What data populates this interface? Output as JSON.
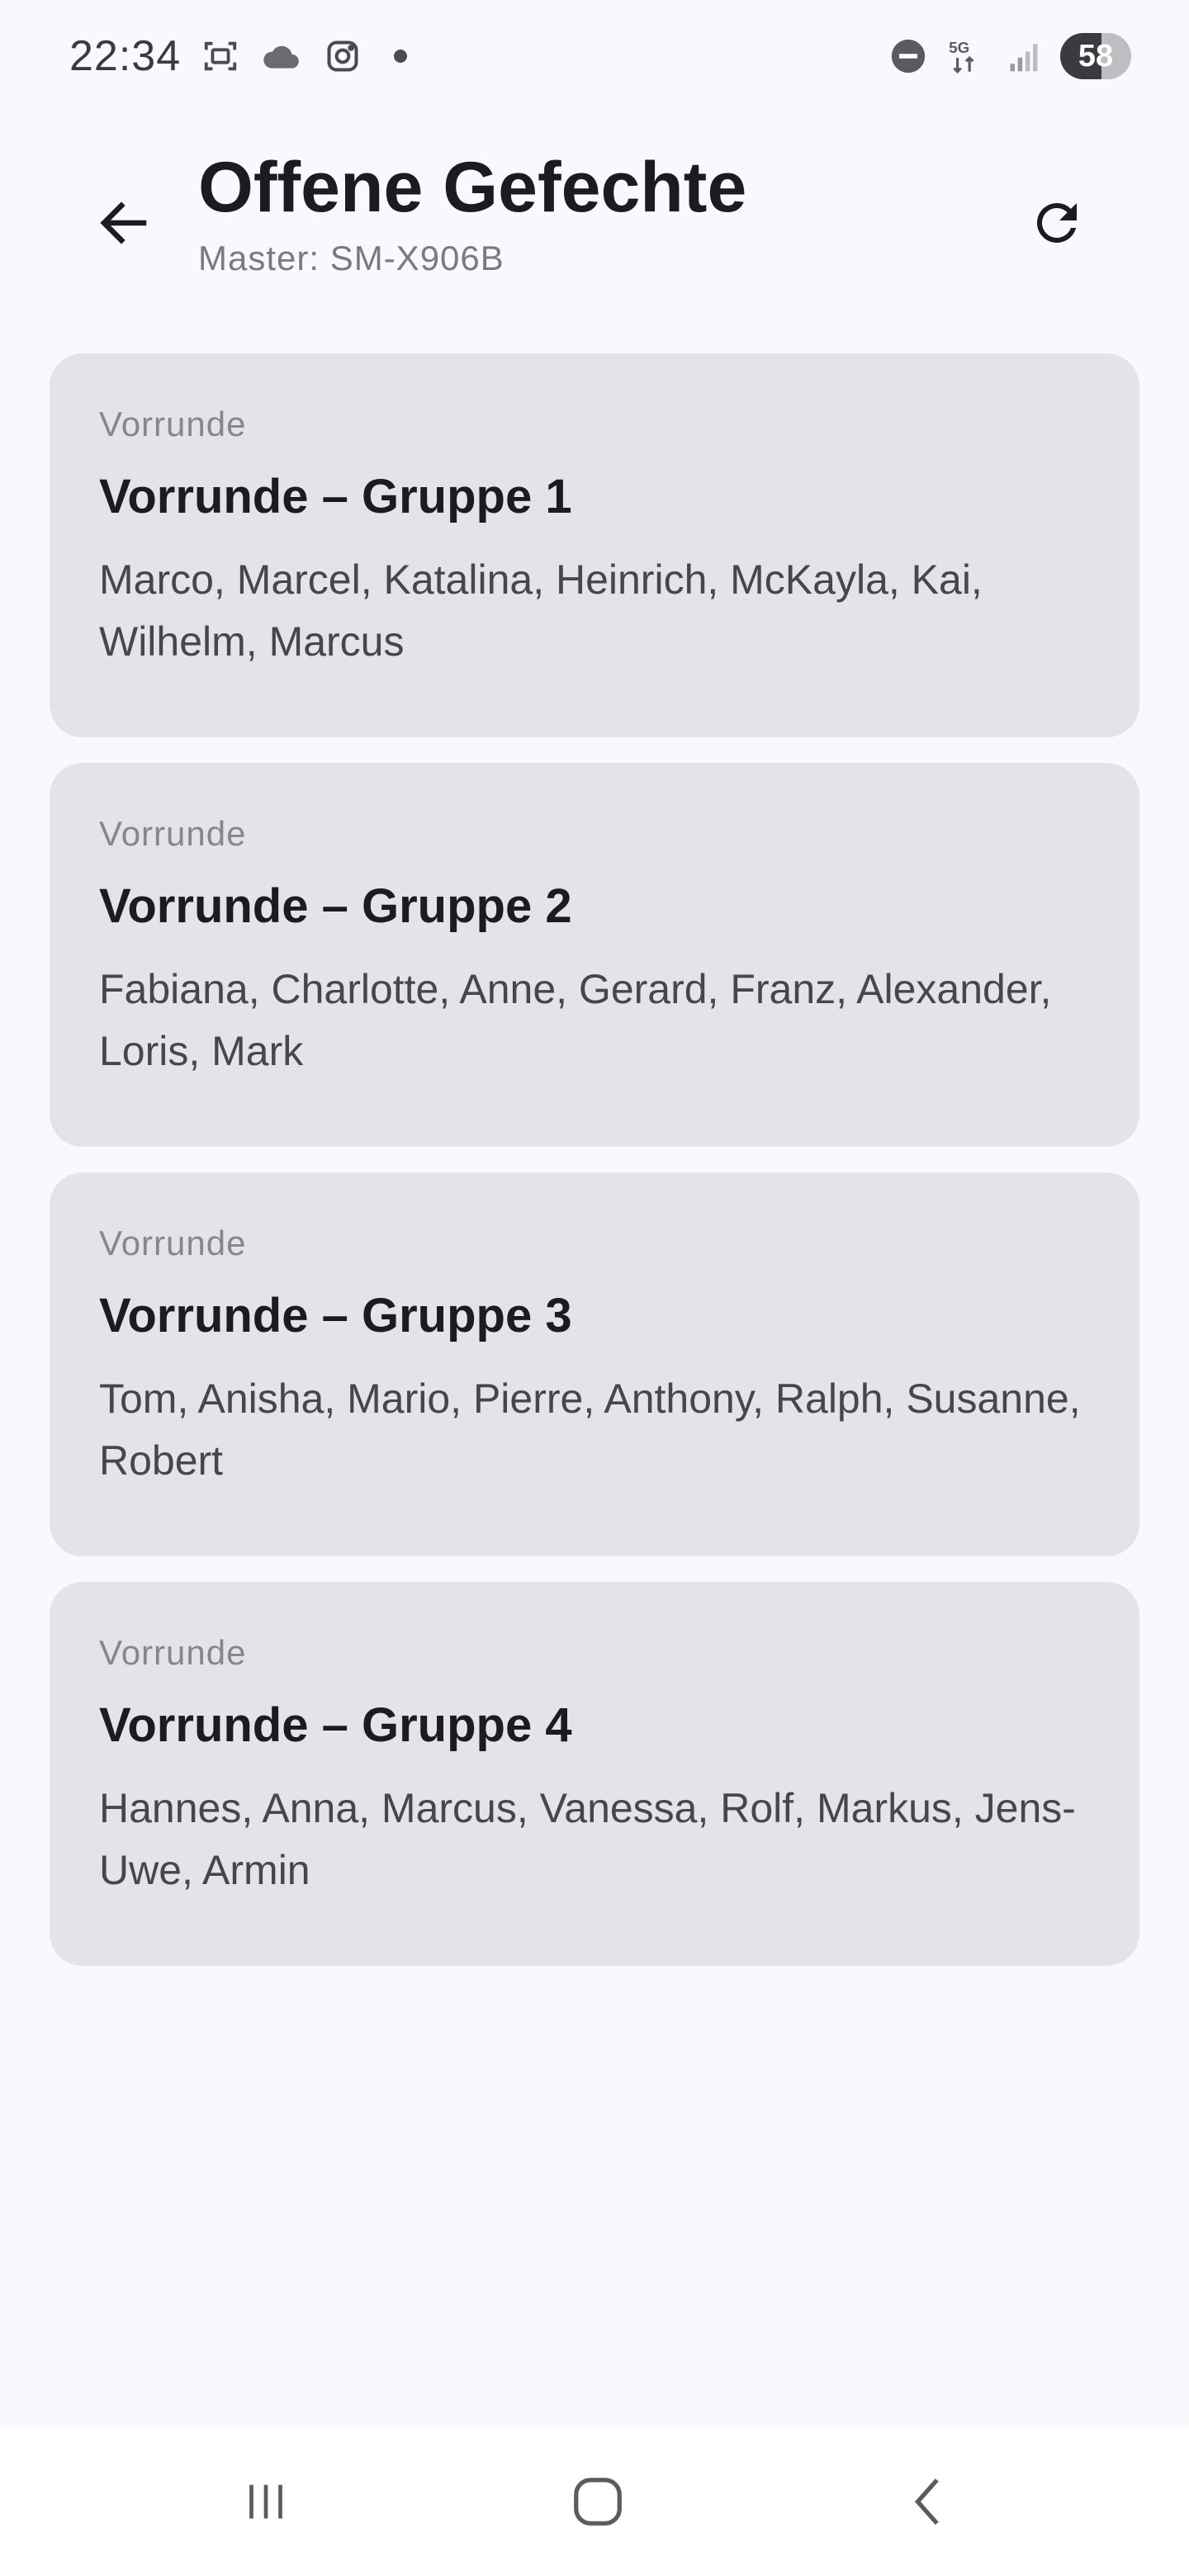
{
  "status_bar": {
    "time": "22:34",
    "network": "5G",
    "battery": "58",
    "battery_level": 0.58,
    "icons": [
      "screenshot-icon",
      "cloud-icon",
      "instagram-icon",
      "notification-dot-icon",
      "do-not-disturb-icon",
      "network-5g-icon",
      "signal-icon",
      "battery-icon"
    ]
  },
  "header": {
    "title": "Offene Gefechte",
    "subtitle": "Master: SM-X906B",
    "back_icon": "arrow-left-icon",
    "refresh_icon": "refresh-icon"
  },
  "fights": [
    {
      "round": "Vorrunde",
      "title": "Vorrunde – Gruppe 1",
      "players": "Marco, Marcel, Katalina, Heinrich, McKayla, Kai, Wilhelm, Marcus"
    },
    {
      "round": "Vorrunde",
      "title": "Vorrunde – Gruppe 2",
      "players": "Fabiana, Charlotte, Anne, Gerard, Franz, Alexander, Loris, Mark"
    },
    {
      "round": "Vorrunde",
      "title": "Vorrunde – Gruppe 3",
      "players": "Tom, Anisha, Mario, Pierre, Anthony, Ralph, Susanne, Robert"
    },
    {
      "round": "Vorrunde",
      "title": "Vorrunde – Gruppe 4",
      "players": "Hannes, Anna, Marcus, Vanessa, Rolf, Markus, Jens-Uwe, Armin"
    }
  ],
  "nav_bar": {
    "icons": [
      "recent-apps-icon",
      "home-icon",
      "back-icon"
    ]
  },
  "colors": {
    "background": "#f8f8fd",
    "card": "#e3e3e8",
    "title": "#1c1b1f",
    "secondary": "#7a7a80"
  }
}
